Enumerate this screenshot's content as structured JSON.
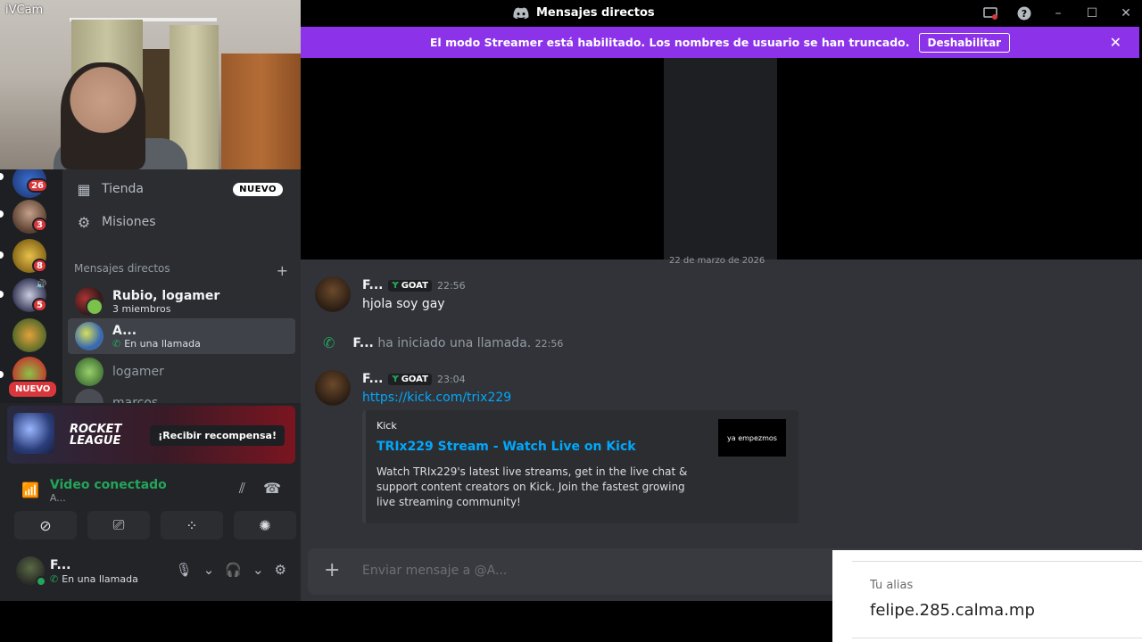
{
  "webcam": {
    "label": "iVCam"
  },
  "titlebar": {
    "title": "Mensajes directos"
  },
  "banner": {
    "text": "El modo Streamer está habilitado. Los nombres de usuario se han truncado.",
    "button": "Deshabilitar"
  },
  "servers": [
    {
      "badge": "26",
      "color": "#2f5fb3"
    },
    {
      "badge": "3",
      "color": "#6a5a4f"
    },
    {
      "badge": "8",
      "color": "#c9a43a"
    },
    {
      "badge": "5",
      "color": "#5a5d7a"
    },
    {
      "badge": "",
      "color": "#b58a2a"
    },
    {
      "badge": "NUEVO",
      "color": "#7aa24a"
    }
  ],
  "dm_nav": {
    "store": "Tienda",
    "store_tag": "NUEVO",
    "quests": "Misiones"
  },
  "dm_section": {
    "title": "Mensajes directos",
    "add": "+"
  },
  "dms": [
    {
      "name": "Rubio, logamer",
      "sub": "3 miembros"
    },
    {
      "name": "A...",
      "sub": "En una llamada"
    },
    {
      "name": "logamer",
      "sub": ""
    },
    {
      "name": "marcos",
      "sub": ""
    }
  ],
  "promo": {
    "logo_line1": "ROCKET",
    "logo_line2": "LEAGUE",
    "button": "¡Recibir recompensa!"
  },
  "voice": {
    "title": "Video conectado",
    "sub": "A..."
  },
  "user": {
    "name": "F...",
    "status": "En una llamada"
  },
  "chat": {
    "date": "22 de marzo de 2026",
    "messages": [
      {
        "author": "F...",
        "tag": "GOAT",
        "time": "22:56",
        "text": "hjola soy gay"
      },
      {
        "author": "F...",
        "tag": "GOAT",
        "time": "23:04",
        "text": "https://kick.com/trix229"
      }
    ],
    "system": {
      "author": "F...",
      "text": "ha iniciado una llamada.",
      "time": "22:56"
    },
    "embed": {
      "provider": "Kick",
      "title": "TRIx229 Stream - Watch Live on Kick",
      "description": "Watch TRIx229's latest live streams, get in the live chat & support content creators on Kick. Join the fastest growing live streaming community!",
      "thumb_text": "ya empezmos"
    },
    "composer_placeholder": "Enviar mensaje a @A..."
  },
  "alias_popup": {
    "label": "Tu alias",
    "value": "felipe.285.calma.mp"
  }
}
